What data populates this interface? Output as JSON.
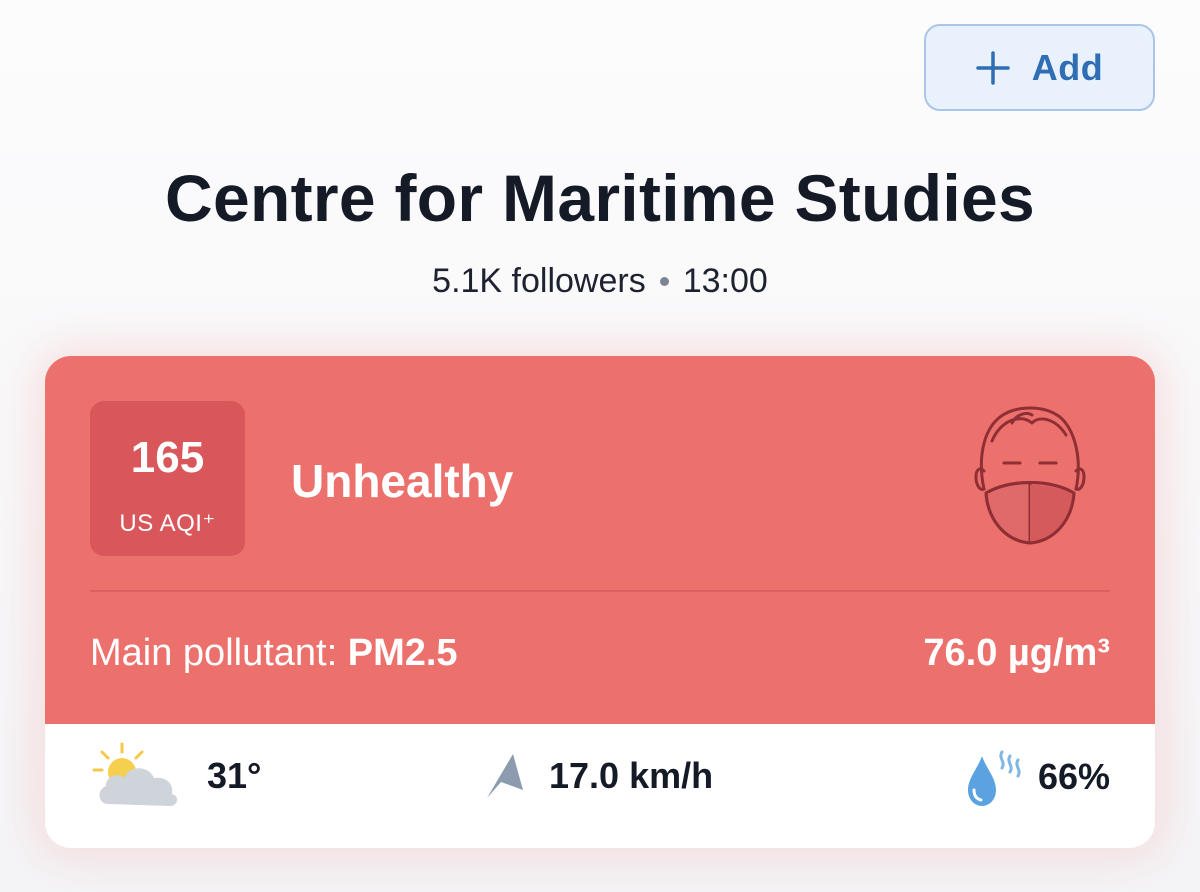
{
  "header": {
    "add_label": "Add"
  },
  "station": {
    "name": "Centre for Maritime Studies",
    "followers": "5.1K followers",
    "time": "13:00"
  },
  "aqi": {
    "value": "165",
    "unit": "US AQI⁺",
    "status": "Unhealthy",
    "pollutant_label": "Main pollutant: ",
    "pollutant_name": "PM2.5",
    "concentration": "76.0 µg/m³"
  },
  "weather": {
    "temperature": "31°",
    "wind": "17.0 km/h",
    "humidity": "66%"
  },
  "icons": [
    "plus-icon",
    "mask-face-icon",
    "partly-sunny-icon",
    "wind-direction-icon",
    "humidity-icon"
  ],
  "colors": {
    "unhealthy_bg": "#ec716d",
    "aqi_box": "#d9575a",
    "accent_blue": "#2f6db4",
    "title_text": "#141a26"
  }
}
